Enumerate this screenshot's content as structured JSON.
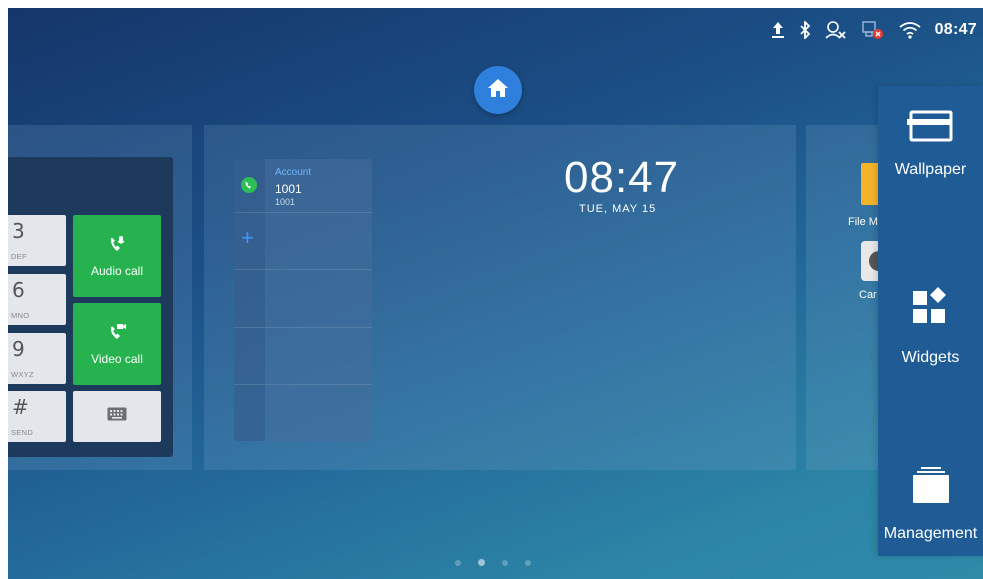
{
  "status_bar": {
    "time": "08:47",
    "icons": [
      "upload-icon",
      "bluetooth-icon",
      "user-off-icon",
      "network-error-icon",
      "wifi-icon"
    ]
  },
  "home": {
    "icon": "home-icon",
    "color": "#2f7fdc"
  },
  "dialer": {
    "keys": [
      {
        "digit": "3",
        "letters": "DEF"
      },
      {
        "digit": "6",
        "letters": "MNO"
      },
      {
        "digit": "9",
        "letters": "WXYZ"
      },
      {
        "digit": "#",
        "letters": "SEND"
      }
    ],
    "audio_call_label": "Audio call",
    "video_call_label": "Video call",
    "call_color": "#26b34f"
  },
  "account_widget": {
    "label": "Account",
    "number": "1001",
    "sub_number": "1001"
  },
  "clock_widget": {
    "time": "08:47",
    "date": "TUE, MAY 15"
  },
  "apps": [
    {
      "label": "File M"
    },
    {
      "label": "Car"
    }
  ],
  "menu": {
    "items": [
      {
        "label": "Wallpaper",
        "icon": "wallpaper-icon"
      },
      {
        "label": "Widgets",
        "icon": "widgets-icon"
      },
      {
        "label": "Management",
        "icon": "management-icon"
      }
    ],
    "color": "#1f5b95"
  },
  "page_indicator": {
    "count": 4,
    "active": 2
  }
}
